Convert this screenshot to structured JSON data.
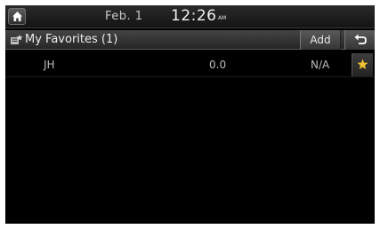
{
  "status_bar": {
    "date": "Feb.  1",
    "time": "12:26",
    "ampm": "AM"
  },
  "title_bar": {
    "title": "My Favorites (1)",
    "add_label": "Add"
  },
  "favorites": [
    {
      "name": "JH",
      "distance": "0.0",
      "status": "N/A",
      "favorite": true
    }
  ],
  "colors": {
    "star": "#f2c230",
    "background": "#000000"
  },
  "icons": [
    "home-icon",
    "favorites-icon",
    "back-arrow-icon",
    "star-icon"
  ]
}
